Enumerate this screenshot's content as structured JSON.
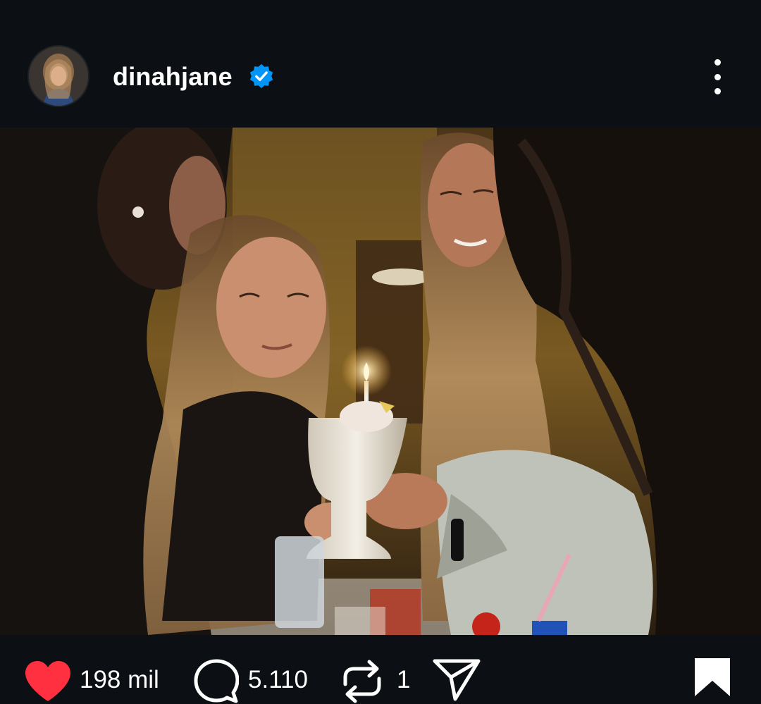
{
  "post": {
    "username": "dinahjane",
    "verified": true,
    "avatar_icon": "profile-avatar",
    "menu_icon": "more-vertical-icon"
  },
  "actions": {
    "like_count": "198 mil",
    "comment_count": "5.110",
    "repost_count": "1",
    "liked": true,
    "saved": true
  },
  "colors": {
    "background": "#0c1014",
    "like_red": "#ff3040",
    "verified_blue": "#0095f6",
    "text": "#ffffff"
  }
}
